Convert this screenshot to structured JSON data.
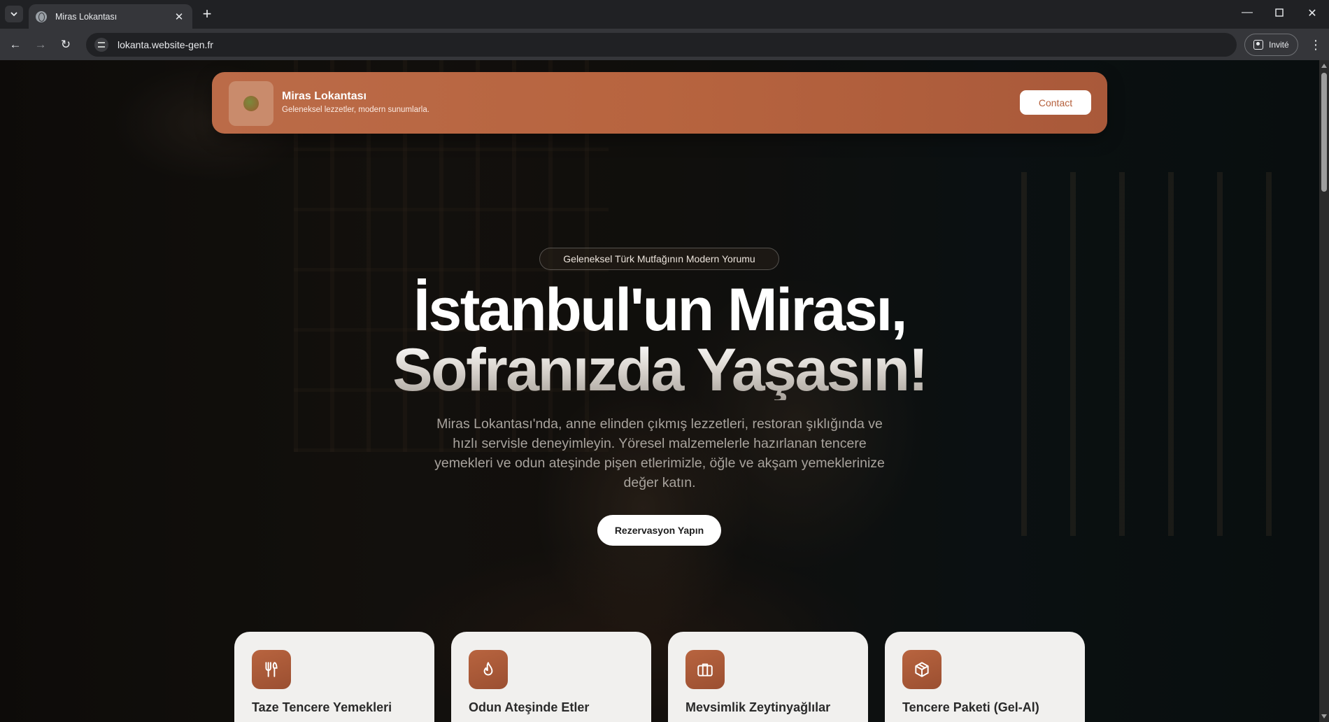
{
  "browser": {
    "tab_title": "Miras Lokantası",
    "url": "lokanta.website-gen.fr",
    "invite_label": "Invité",
    "window_controls": [
      "minimize-icon",
      "maximize-icon",
      "close-icon"
    ]
  },
  "header": {
    "brand_name": "Miras Lokantası",
    "tagline": "Geleneksel lezzetler, modern sunumlarla.",
    "contact_label": "Contact",
    "colors": {
      "accent": "#b7643f",
      "accent_dark": "#a9593a"
    }
  },
  "hero": {
    "badge": "Geleneksel Türk Mutfağının Modern Yorumu",
    "title_line1": "İstanbul'un Mirası,",
    "title_line2": "Sofranızda Yaşasın!",
    "description": "Miras Lokantası'nda, anne elinden çıkmış lezzetleri, restoran şıklığında ve hızlı servisle deneyimleyin. Yöresel malzemelerle hazırlanan tencere yemekleri ve odun ateşinde pişen etlerimizle, öğle ve akşam yemeklerinize değer katın.",
    "cta_label": "Rezervasyon Yapın"
  },
  "features": [
    {
      "title": "Taze Tencere Yemekleri",
      "icon": "utensils-icon"
    },
    {
      "title": "Odun Ateşinde Etler",
      "icon": "flame-icon"
    },
    {
      "title": "Mevsimlik Zeytinyağlılar",
      "icon": "briefcase-icon"
    },
    {
      "title": "Tencere Paketi (Gel-Al)",
      "icon": "package-icon"
    }
  ]
}
